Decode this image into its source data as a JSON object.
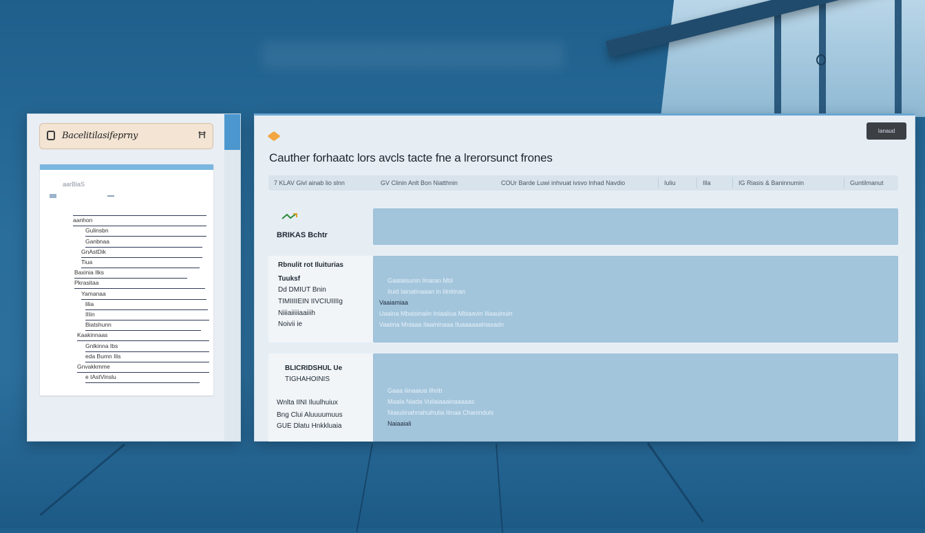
{
  "sidebar_doc": {
    "header_title": "Bacelitilasifeprny",
    "header_action": "Ħ",
    "meta_line1": "aarBlaS",
    "lines": [
      {
        "label": "",
        "indent": 48,
        "width": 194
      },
      {
        "label": "aanhon",
        "indent": 48,
        "width": 194
      },
      {
        "label": "Gulinsbn",
        "indent": 66,
        "width": 176
      },
      {
        "label": "Ganbnaa",
        "indent": 66,
        "width": 170
      },
      {
        "label": "GnAstDik",
        "indent": 60,
        "width": 176
      },
      {
        "label": "Tiua",
        "indent": 60,
        "width": 172
      },
      {
        "label": "Baxinia Ilks",
        "indent": 50,
        "width": 164
      },
      {
        "label": "Pkrasitaa",
        "indent": 50,
        "width": 190
      },
      {
        "label": "Yamanaa",
        "indent": 60,
        "width": 182
      },
      {
        "label": "lilia",
        "indent": 66,
        "width": 178
      },
      {
        "label": "IIIin",
        "indent": 66,
        "width": 180
      },
      {
        "label": "Biatshunn",
        "indent": 66,
        "width": 168
      },
      {
        "label": "Kaakinnaas",
        "indent": 54,
        "width": 192
      },
      {
        "label": "Gnlkinna Ibs",
        "indent": 66,
        "width": 180
      },
      {
        "label": "eda Bumn Ilis",
        "indent": 66,
        "width": 180
      },
      {
        "label": "Gnvakkmme",
        "indent": 54,
        "width": 192
      },
      {
        "label": "e tAstVinslu",
        "indent": 66,
        "width": 166
      }
    ]
  },
  "main": {
    "action_button": "Ianaud",
    "title": "Cauther forhaatc lors avcls tacte fne a lrerorsunct  frones",
    "columns": [
      {
        "label": "7  KLAV Givl   ainab lio slnn"
      },
      {
        "label": "GV  Clinin  Anlt  Bon  Niatthnin"
      },
      {
        "label": "COUr  Barde Luwi inhvuat ivsvo lnhad Navdio"
      },
      {
        "label": "Iuliu"
      },
      {
        "label": "Illa"
      },
      {
        "label": "IG Riasis & Baninnumin"
      },
      {
        "label": "Guntilmanut"
      }
    ],
    "rows": [
      {
        "labels": [
          "BRIKAS   Bchtr"
        ],
        "bar_texts": []
      },
      {
        "labels": [
          "Rbnulit rot Iluiturias",
          "Tuuksf",
          "Dd DMIUT Bnin",
          "TIMIIIIEIN IIVCIUIIIIg",
          "Niiiaiiiiiaaiiih",
          "Noivii ie"
        ],
        "bar_texts": [
          "Gaataisunin Iinaran Mbl",
          "Iluid  Iainatinaaan in Iilnitinan",
          "Vaaiamiaa",
          "Uaaina Mbaisinaiin Iniaaliua Mbiaavin Iliaauinuin",
          "Vaaiina Mniaaa Ilaaininaaa Iluaaaaaahiasadn"
        ]
      },
      {
        "labels": [
          "BLICRIDSHUL  Ue",
          "TIGHAHOINIS",
          "Wnlta IINI Iluulhuiux",
          "Bng Clui Aluuuumuus",
          "GUE Dlatu Hnkkluaia"
        ],
        "bar_texts": [
          "Gaaa iiinaaiua Ilhrib",
          "Maala Niada Vuilaiaaainaaaaas",
          "Niaiuiiinahnahuihulia Iilnaa  Chaninduls",
          "Naiaaiali"
        ]
      }
    ]
  }
}
